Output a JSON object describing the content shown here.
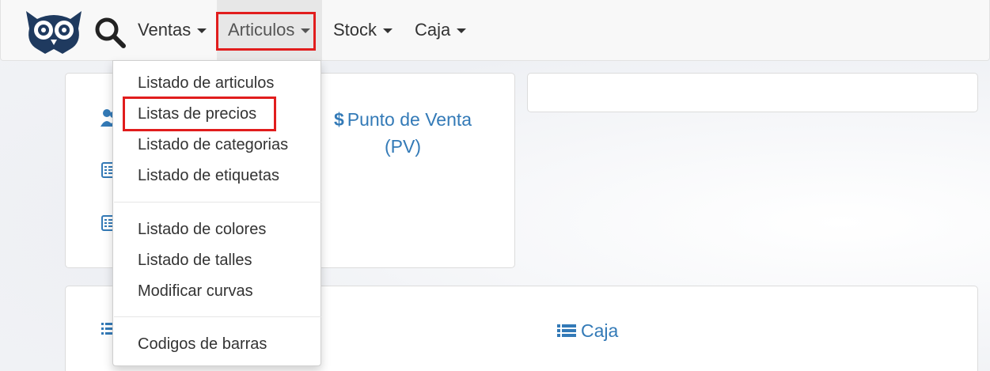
{
  "navbar": {
    "logo_icon": "owl-logo-icon",
    "search_icon": "search-icon",
    "items": [
      {
        "label": "Ventas"
      },
      {
        "label": "Articulos"
      },
      {
        "label": "Stock"
      },
      {
        "label": "Caja"
      }
    ]
  },
  "dropdown": {
    "groups": [
      [
        "Listado de articulos",
        "Listas de precios",
        "Listado de categorias",
        "Listado de etiquetas"
      ],
      [
        "Listado de colores",
        "Listado de talles",
        "Modificar curvas"
      ],
      [
        "Codigos de barras"
      ]
    ]
  },
  "panels": {
    "punto_venta": {
      "icon": "dollar-icon",
      "symbol": "$",
      "line1": "Punto de Venta",
      "line2": "(PV)"
    },
    "caja": {
      "icon": "list-icon",
      "label": "Caja"
    }
  },
  "colors": {
    "link": "#337ab7",
    "highlight": "#e11d1d",
    "logo": "#1f3a5f"
  }
}
